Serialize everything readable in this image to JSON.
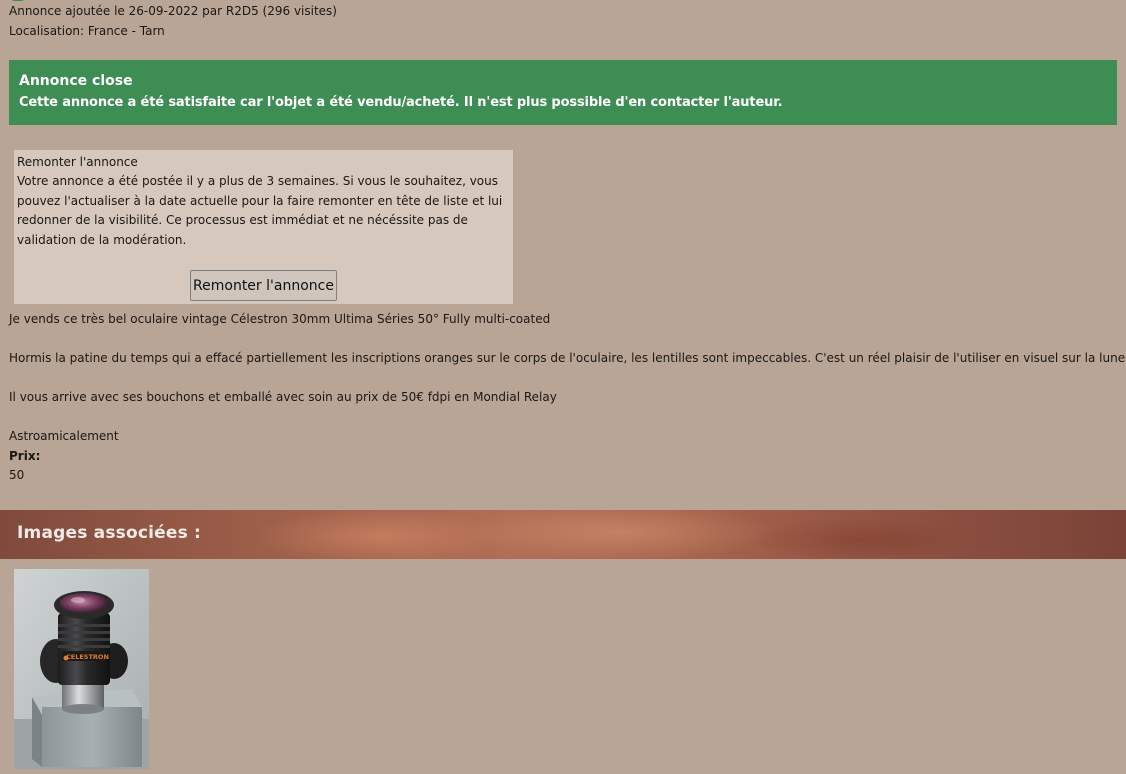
{
  "listing": {
    "added_line": "Annonce ajoutée le 26-09-2022 par R2D5 (296 visites)",
    "location_line": "Localisation: France - Tarn"
  },
  "closed_banner": {
    "title": "Annonce close",
    "message": "Cette annonce a été satisfaite car l'objet a été vendu/acheté. Il n'est plus possible d'en contacter l'auteur.",
    "color": "#3e8d55"
  },
  "bump": {
    "title": "Remonter l'annonce",
    "text": "Votre annonce a été postée il y a plus de 3 semaines. Si vous le souhaitez, vous pouvez l'actualiser à la date actuelle pour la faire remonter en tête de liste et lui redonner de la visibilité. Ce processus est immédiat et ne nécéssite pas de validation de la modération.",
    "button_label": "Remonter l'annonce"
  },
  "description": {
    "line1": "Je vends ce très bel oculaire vintage Célestron 30mm Ultima Séries 50° Fully multi-coated",
    "line2": "Hormis la patine du temps qui a effacé partiellement les inscriptions oranges sur le corps de l'oculaire, les lentilles sont impeccables. C'est un réel plaisir de l'utiliser en visuel sur la lune.",
    "line3": "Il vous arrive avec ses bouchons et emballé avec soin au prix de 50€ fdpi en Mondial Relay",
    "line4": "Astroamicalement"
  },
  "price": {
    "label": "Prix:",
    "value": "50"
  },
  "images": {
    "header": "Images associées :",
    "items": [
      {
        "icon": "eyepiece-photo",
        "lens_brand_text": "CELESTRON"
      }
    ]
  },
  "colors": {
    "page_background": "#b8a596",
    "box_background": "#d6c8bd",
    "header_band": "#a9654e"
  }
}
